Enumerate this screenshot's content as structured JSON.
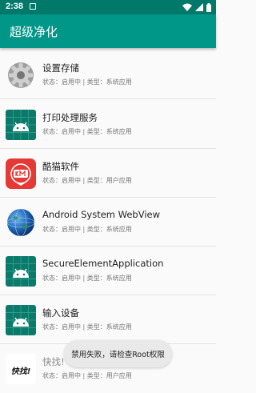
{
  "status_bar": {
    "time": "2:38"
  },
  "app_bar": {
    "title": "超级净化"
  },
  "apps": [
    {
      "name": "设置存储",
      "status": "状态：启用中 | 类型：系统应用",
      "icon": "settings-gear-icon"
    },
    {
      "name": "打印处理服务",
      "status": "状态：启用中 | 类型：系统应用",
      "icon": "android-robot-icon"
    },
    {
      "name": "酷猫软件",
      "status": "状态：启用中 | 类型：用户应用",
      "icon": "km-logo-icon"
    },
    {
      "name": "Android System WebView",
      "status": "状态：启用中 | 类型：系统应用",
      "icon": "globe-icon"
    },
    {
      "name": "SecureElementApplication",
      "status": "状态：启用中 | 类型：系统应用",
      "icon": "android-robot-icon"
    },
    {
      "name": "输入设备",
      "status": "状态：启用中 | 类型：系统应用",
      "icon": "android-robot-icon"
    },
    {
      "name": "快找!",
      "status": "状态：启用中 | 类型：用户应用",
      "icon": "kuaizhao-logo-icon"
    }
  ],
  "toast": {
    "text": "禁用失败，请检查Root权限"
  },
  "colors": {
    "primary": "#009688",
    "primary_dark": "#00796b"
  }
}
